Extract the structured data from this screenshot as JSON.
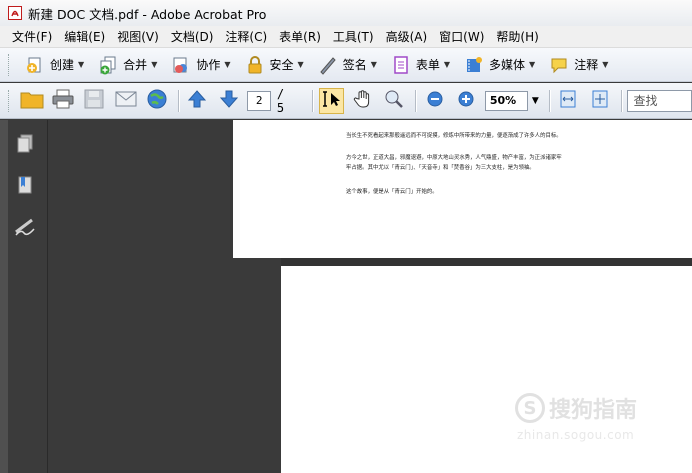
{
  "window": {
    "title": "新建 DOC 文档.pdf - Adobe Acrobat Pro"
  },
  "menu": [
    "文件(F)",
    "编辑(E)",
    "视图(V)",
    "文档(D)",
    "注释(C)",
    "表单(R)",
    "工具(T)",
    "高级(A)",
    "窗口(W)",
    "帮助(H)"
  ],
  "tasks": {
    "create": "创建",
    "combine": "合并",
    "collaborate": "协作",
    "secure": "安全",
    "sign": "签名",
    "forms": "表单",
    "multimedia": "多媒体",
    "comment": "注释"
  },
  "toolbar": {
    "page_current": "2",
    "page_total": "/ 5",
    "zoom": "50%",
    "find_placeholder": "查找"
  },
  "document": {
    "line1": "当长生不死看起来那般遥远而不可捉摸，修炼中所带来的力量，便逐渐成了许多人的目标。",
    "line2": "方今之世，正道大昌，邪魔退避，中原大地山灵水秀，人气鼎盛，物产丰富，为正派诸家牢",
    "line3": "牢占据。其中尤以「青云门」、「天音寺」和「焚香谷」为三大支柱，是为领袖。",
    "line4": "这个故事，便是从「青云门」开始的。"
  },
  "watermark": {
    "brand": "搜狗指南",
    "url": "zhinan.sogou.com"
  },
  "colors": {
    "accent_red": "#c01c1c",
    "nav_bg": "#3b3b3b",
    "toolbar_blue": "#3b7fd4"
  }
}
